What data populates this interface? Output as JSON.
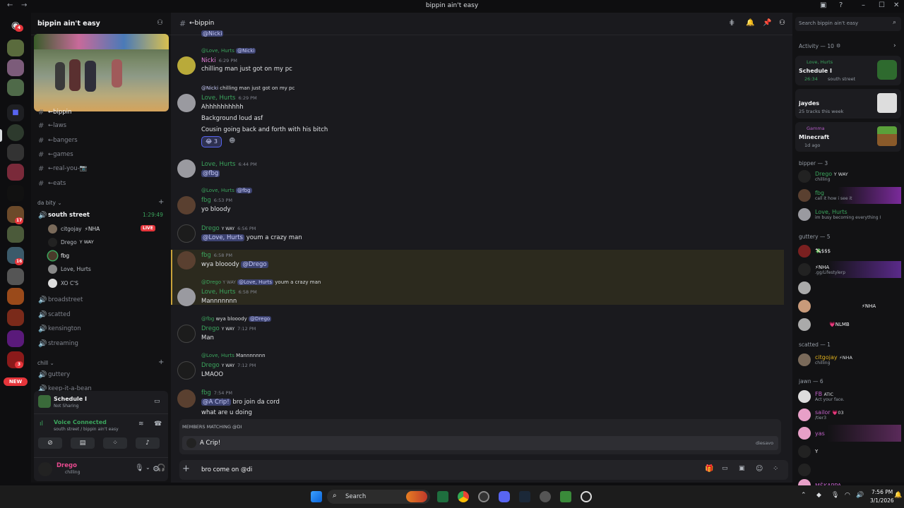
{
  "window": {
    "title": "bippin ain't easy"
  },
  "server": {
    "name": "bippin ain't easy",
    "channels_top": [
      "←bippin",
      "←laws",
      "←bangers",
      "←games",
      "←real-you-📷",
      "←eats"
    ],
    "category_da_bity": "da bity",
    "south_street": {
      "name": "south street",
      "timer": "1:29:49"
    },
    "voice_users": [
      {
        "name": "citgojay",
        "tag": "⚡NHA",
        "live": "LIVE"
      },
      {
        "name": "Drego",
        "tag": "Y WAY"
      },
      {
        "name": "fbg"
      },
      {
        "name": "Love, Hurts"
      },
      {
        "name": "XO C'S"
      }
    ],
    "voice_channels": [
      "broadstreet",
      "scatted",
      "kensington",
      "streaming"
    ],
    "category_chill": "chill",
    "chill_channels": [
      "guttery",
      "keep-it-a-bean"
    ]
  },
  "activity_panel": {
    "game": "Schedule I",
    "sub": "Not Sharing"
  },
  "voice_panel": {
    "status": "Voice Connected",
    "sub": "south street / bippin ain't easy"
  },
  "user_panel": {
    "name": "Drego",
    "status": "chilling"
  },
  "rail": {
    "home_badge": "4",
    "new_label": "NEW",
    "badges": [
      "17",
      "16",
      "3"
    ]
  },
  "chat": {
    "channel": "←bippin",
    "top_cutoff": "@Nicki",
    "messages": [
      {
        "reply_name": "@Love, Hurts",
        "reply_mention": "@Nicki",
        "author": "Nicki",
        "color": "#e67fd9",
        "time": "6:29 PM",
        "lines": [
          "chilling man just got on my pc"
        ]
      },
      {
        "reply_name": "@Nicki",
        "reply_text": "chilling man just got on my pc",
        "author": "Love, Hurts",
        "color": "#3ba55d",
        "time": "6:29 PM",
        "lines": [
          "Ahhhhhhhhhh",
          "Background loud asf",
          "Cousin going back and forth with his bitch"
        ],
        "reaction": "😂 3"
      },
      {
        "author": "Love, Hurts",
        "color": "#3ba55d",
        "time": "6:44 PM",
        "mention_line": "@fbg"
      },
      {
        "reply_name": "@Love, Hurts",
        "reply_mention": "@fbg",
        "author": "fbg",
        "color": "#3ba55d",
        "time": "6:53 PM",
        "lines": [
          "yo bloody"
        ]
      },
      {
        "author": "Drego",
        "tag": "Y WAY",
        "color": "#3ba55d",
        "time": "6:56 PM",
        "mention": "@Love, Hurts",
        "after": "youm a crazy man"
      },
      {
        "author": "fbg",
        "color": "#3ba55d",
        "time": "6:58 PM",
        "before": "wya blooody",
        "mention": "@Drego"
      },
      {
        "reply_name": "@Drego",
        "reply_tag": "Y WAY",
        "reply_mention": "@Love, Hurts",
        "reply_text": "youm a crazy man",
        "author": "Love, Hurts",
        "color": "#3ba55d",
        "time": "6:58 PM",
        "lines": [
          "Mannnnnnn"
        ]
      },
      {
        "reply_name": "@fbg",
        "reply_text": "wya blooody",
        "reply_mention": "@Drego",
        "author": "Drego",
        "tag": "Y WAY",
        "color": "#3ba55d",
        "time": "7:12 PM",
        "lines": [
          "Man"
        ]
      },
      {
        "reply_name": "@Love, Hurts",
        "reply_text": "Mannnnnnn",
        "author": "Drego",
        "tag": "Y WAY",
        "color": "#3ba55d",
        "time": "7:12 PM",
        "lines": [
          "LMAOO"
        ]
      },
      {
        "author": "fbg",
        "color": "#3ba55d",
        "time": "7:54 PM",
        "mention": "@A Crip!",
        "after": "bro join da cord",
        "line2": "what are u doing"
      }
    ],
    "autocomplete": {
      "title": "MEMBERS MATCHING @DI",
      "name": "A Crip!",
      "username": "diesavo"
    },
    "composer": {
      "value": "bro come on @di"
    }
  },
  "search": {
    "placeholder": "Search bippin ain't easy"
  },
  "activity": {
    "title": "Activity — 10",
    "cards": [
      {
        "user": "Love, Hurts",
        "title": "Schedule I",
        "sub": "26:34",
        "sub2": "south street"
      },
      {
        "user": "",
        "title": "jaydes",
        "sub": "25 tracks this week"
      },
      {
        "user": "Gamma",
        "title": "Minecraft",
        "sub": "1d ago"
      }
    ]
  },
  "members": {
    "groups": [
      {
        "label": "bipper — 3",
        "members": [
          {
            "name": "Drego",
            "tag": "Y WAY",
            "status": "chilling",
            "color": "#3ba55d"
          },
          {
            "name": "fbg",
            "status": "call it how i see it",
            "color": "#3ba55d"
          },
          {
            "name": "Love, Hurts",
            "status": "im busy becoming everything I",
            "color": "#3ba55d"
          }
        ]
      },
      {
        "label": "guttery — 5",
        "members": [
          {
            "name": "",
            "tag": "💸$$$",
            "color": "#d83c3e"
          },
          {
            "name": "",
            "tag": "⚡NHA",
            "status": ".gg/Lifestylerp",
            "color": "#d83c3e"
          },
          {
            "name": "",
            "color": "#d83c3e"
          },
          {
            "name": "",
            "tag": "⚡NHA",
            "color": "#d83c3e"
          },
          {
            "name": "",
            "tag": "💗NLMB",
            "color": "#d83c3e"
          }
        ]
      },
      {
        "label": "scatted — 1",
        "members": [
          {
            "name": "citgojay",
            "tag": "⚡NHA",
            "status": "chilling",
            "color": "#e0b01c"
          }
        ]
      },
      {
        "label": "jawn — 6",
        "members": [
          {
            "name": "FB",
            "tag": "ATIC",
            "status": "Act your face.",
            "color": "#c061c7"
          },
          {
            "name": "sailor",
            "tag": "💗03",
            "status": "/tier3",
            "color": "#c061c7"
          },
          {
            "name": "yas",
            "color": "#c061c7"
          },
          {
            "name": "",
            "tag": "Y",
            "color": "#c061c7"
          },
          {
            "name": "",
            "color": "#c061c7"
          },
          {
            "name": "MŠKAPPA",
            "color": "#c061c7"
          }
        ]
      }
    ]
  },
  "taskbar": {
    "search": "Search",
    "time": "7:56 PM",
    "date": "3/1/2026"
  }
}
